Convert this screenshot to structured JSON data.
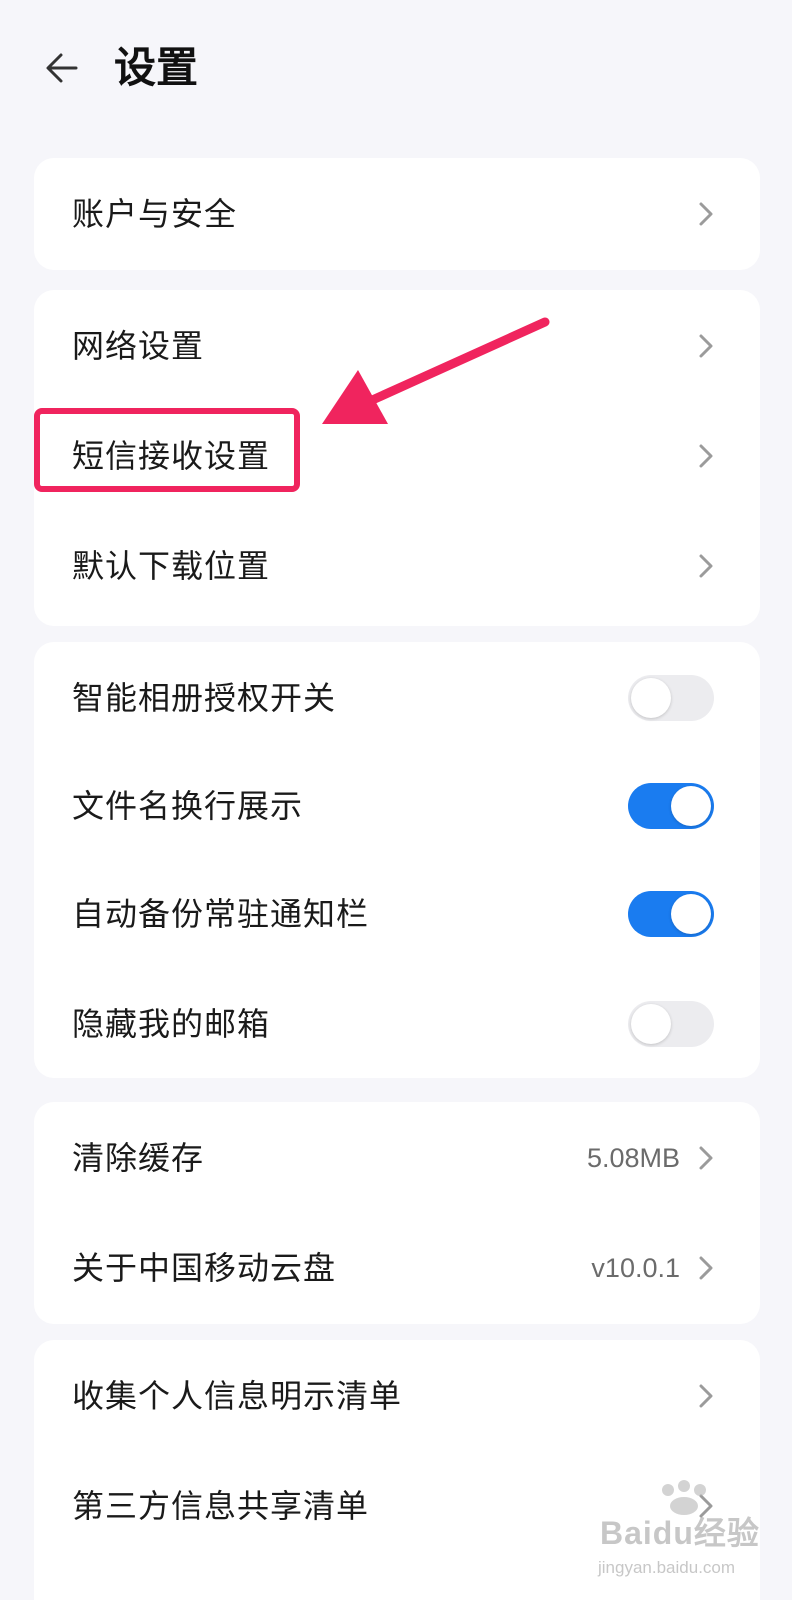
{
  "header": {
    "title": "设置",
    "back_icon": "arrow-left-icon"
  },
  "groups": [
    {
      "items": [
        {
          "label": "账户与安全",
          "type": "link"
        }
      ]
    },
    {
      "items": [
        {
          "label": "网络设置",
          "type": "link"
        },
        {
          "label": "短信接收设置",
          "type": "link",
          "highlighted": true
        },
        {
          "label": "默认下载位置",
          "type": "link"
        }
      ]
    },
    {
      "items": [
        {
          "label": "智能相册授权开关",
          "type": "toggle",
          "on": false
        },
        {
          "label": "文件名换行展示",
          "type": "toggle",
          "on": true
        },
        {
          "label": "自动备份常驻通知栏",
          "type": "toggle",
          "on": true
        },
        {
          "label": "隐藏我的邮箱",
          "type": "toggle",
          "on": false
        }
      ]
    },
    {
      "items": [
        {
          "label": "清除缓存",
          "type": "link",
          "value": "5.08MB"
        },
        {
          "label": "关于中国移动云盘",
          "type": "link",
          "value": "v10.0.1"
        }
      ]
    },
    {
      "items": [
        {
          "label": "收集个人信息明示清单",
          "type": "link"
        },
        {
          "label": "第三方信息共享清单",
          "type": "link"
        }
      ]
    }
  ],
  "annotation": {
    "box_color": "#f0245e",
    "arrow_color": "#f0245e"
  },
  "colors": {
    "toggle_on": "#1a7cf0",
    "toggle_off": "#ececef",
    "background": "#f6f6fa"
  },
  "watermark": {
    "text": "Baidu经验",
    "sub": "jingyan.baidu.com"
  }
}
